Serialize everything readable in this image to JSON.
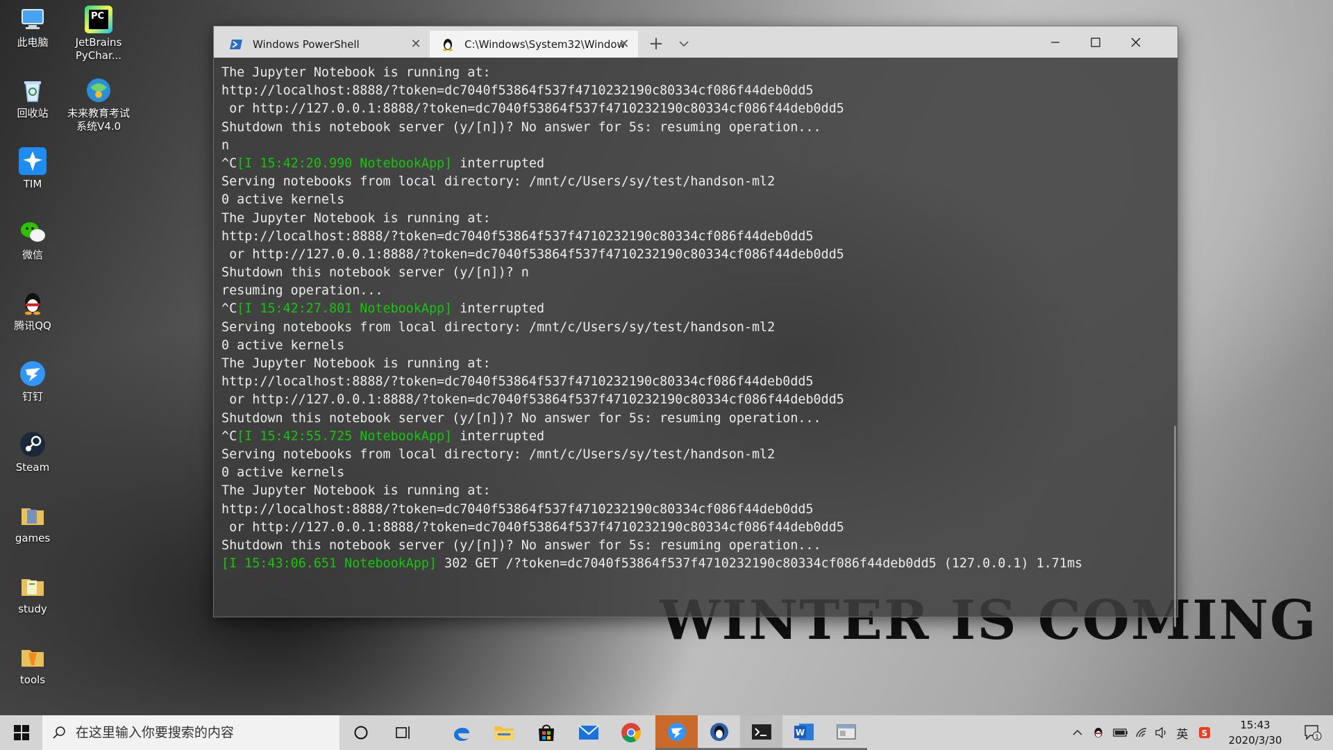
{
  "desktop": {
    "icons": [
      {
        "label": "此电脑",
        "icon": "computer-icon",
        "color": "#4aa3f0"
      },
      {
        "label": "JetBrains PyChar...",
        "icon": "pycharm-icon",
        "color": "#1a1a1a"
      },
      {
        "label": "回收站",
        "icon": "recycle-bin-icon",
        "color": "#bfe0ff"
      },
      {
        "label": "未来教育考试系统V4.0",
        "icon": "exam-system-icon",
        "color": "#2a8fd8"
      },
      {
        "label": "TIM",
        "icon": "tim-icon",
        "color": "#1e8cf0"
      },
      {
        "label": "微信",
        "icon": "wechat-icon",
        "color": "#2dc100"
      },
      {
        "label": "腾讯QQ",
        "icon": "qq-icon",
        "color": "#111111"
      },
      {
        "label": "钉钉",
        "icon": "dingtalk-icon",
        "color": "#3296fa"
      },
      {
        "label": "Steam",
        "icon": "steam-icon",
        "color": "#1b2838"
      },
      {
        "label": "games",
        "icon": "folder-icon",
        "color": "#e8c15a"
      },
      {
        "label": "study",
        "icon": "folder-icon",
        "color": "#e8c15a"
      },
      {
        "label": "tools",
        "icon": "folder-icon",
        "color": "#e8c15a"
      }
    ],
    "wallpaper_text": "WINTER IS COMING"
  },
  "terminal": {
    "tabs": [
      {
        "label": "Windows PowerShell",
        "icon": "powershell-icon",
        "active": false
      },
      {
        "label": "C:\\Windows\\System32\\Window",
        "icon": "linux-penguin-icon",
        "active": true
      }
    ],
    "new_tab_label": "+",
    "lines": [
      {
        "text": "The Jupyter Notebook is running at:"
      },
      {
        "text": "http://localhost:8888/?token=dc7040f53864f537f4710232190c80334cf086f44deb0dd5"
      },
      {
        "text": " or http://127.0.0.1:8888/?token=dc7040f53864f537f4710232190c80334cf086f44deb0dd5"
      },
      {
        "text": "Shutdown this notebook server (y/[n])? No answer for 5s: resuming operation..."
      },
      {
        "text": "n"
      },
      {
        "prefix": "^C",
        "green": "[I 15:42:20.990 NotebookApp]",
        "text": " interrupted"
      },
      {
        "text": "Serving notebooks from local directory: /mnt/c/Users/sy/test/handson-ml2"
      },
      {
        "text": "0 active kernels"
      },
      {
        "text": "The Jupyter Notebook is running at:"
      },
      {
        "text": "http://localhost:8888/?token=dc7040f53864f537f4710232190c80334cf086f44deb0dd5"
      },
      {
        "text": " or http://127.0.0.1:8888/?token=dc7040f53864f537f4710232190c80334cf086f44deb0dd5"
      },
      {
        "text": "Shutdown this notebook server (y/[n])? n"
      },
      {
        "text": "resuming operation..."
      },
      {
        "prefix": "^C",
        "green": "[I 15:42:27.801 NotebookApp]",
        "text": " interrupted"
      },
      {
        "text": "Serving notebooks from local directory: /mnt/c/Users/sy/test/handson-ml2"
      },
      {
        "text": "0 active kernels"
      },
      {
        "text": "The Jupyter Notebook is running at:"
      },
      {
        "text": "http://localhost:8888/?token=dc7040f53864f537f4710232190c80334cf086f44deb0dd5"
      },
      {
        "text": " or http://127.0.0.1:8888/?token=dc7040f53864f537f4710232190c80334cf086f44deb0dd5"
      },
      {
        "text": "Shutdown this notebook server (y/[n])? No answer for 5s: resuming operation..."
      },
      {
        "prefix": "^C",
        "green": "[I 15:42:55.725 NotebookApp]",
        "text": " interrupted"
      },
      {
        "text": "Serving notebooks from local directory: /mnt/c/Users/sy/test/handson-ml2"
      },
      {
        "text": "0 active kernels"
      },
      {
        "text": "The Jupyter Notebook is running at:"
      },
      {
        "text": "http://localhost:8888/?token=dc7040f53864f537f4710232190c80334cf086f44deb0dd5"
      },
      {
        "text": " or http://127.0.0.1:8888/?token=dc7040f53864f537f4710232190c80334cf086f44deb0dd5"
      },
      {
        "text": "Shutdown this notebook server (y/[n])? No answer for 5s: resuming operation..."
      },
      {
        "green": "[I 15:43:06.651 NotebookApp]",
        "text": " 302 GET /?token=dc7040f53864f537f4710232190c80334cf086f44deb0dd5 (127.0.0.1) 1.71ms"
      }
    ]
  },
  "taskbar": {
    "search_placeholder": "在这里输入你要搜索的内容",
    "tray": {
      "ime": "英"
    },
    "clock": {
      "time": "15:43",
      "date": "2020/3/30"
    },
    "notification_count": "1"
  }
}
